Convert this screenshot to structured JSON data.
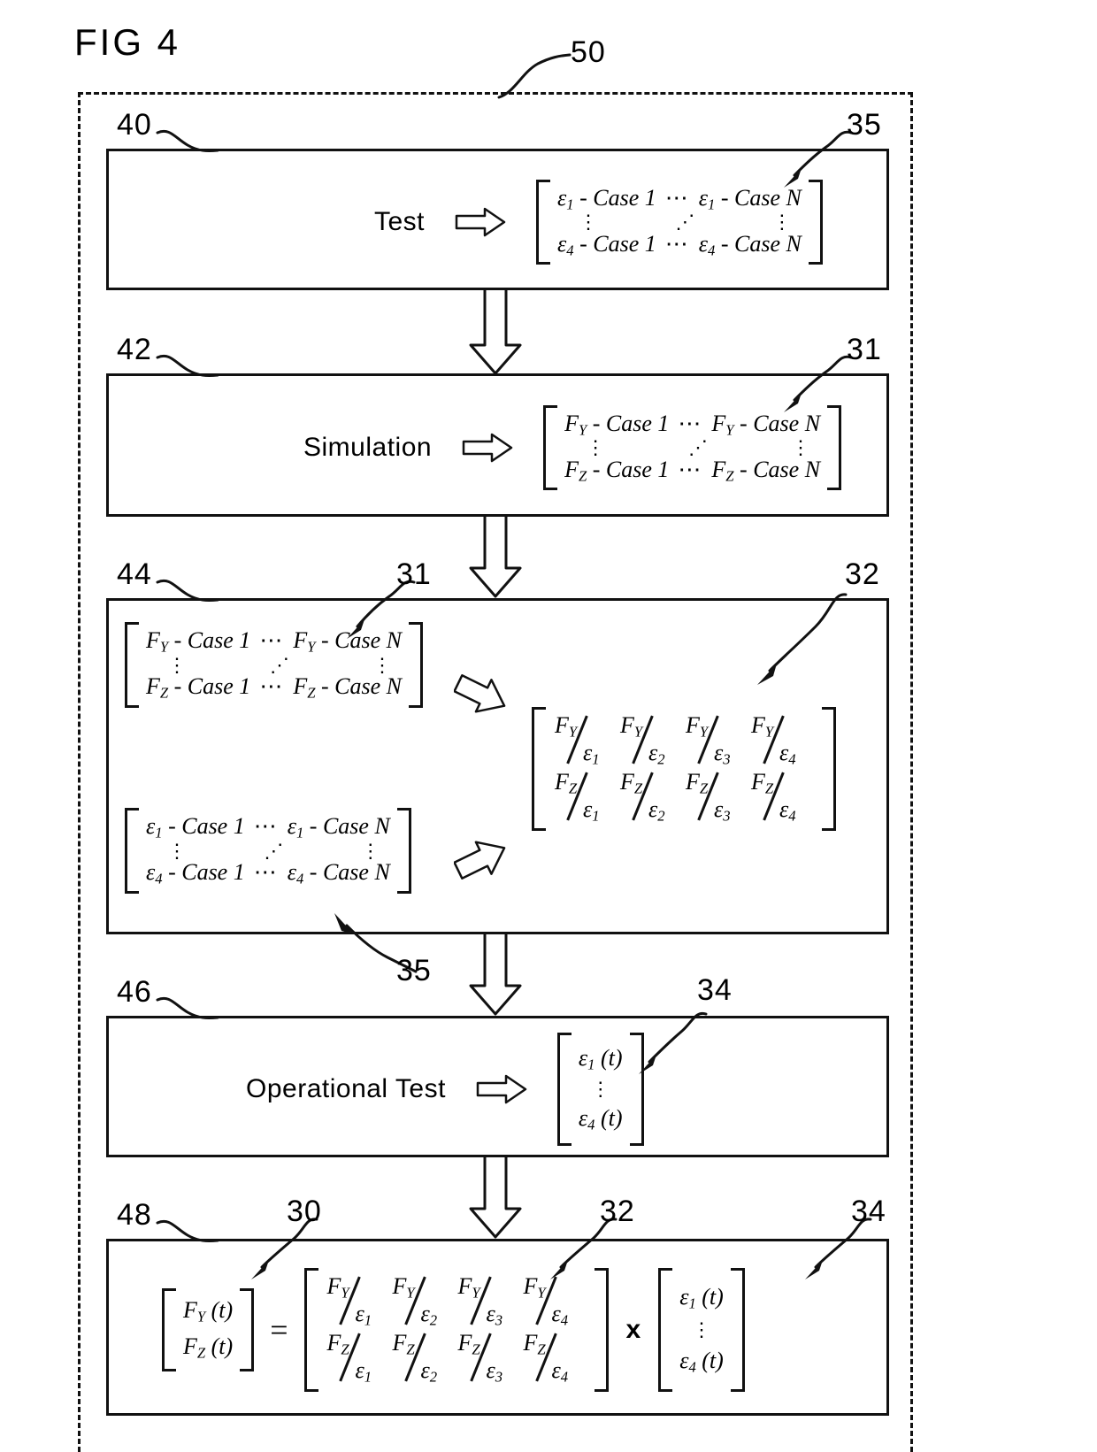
{
  "figure": {
    "title": "FIG 4",
    "outer_ref": "50"
  },
  "refs": {
    "box40": "40",
    "box42": "42",
    "box44": "44",
    "box46": "46",
    "box48": "48",
    "strain_matrix": "35",
    "force_matrix": "31",
    "force_matrix_in_44": "31",
    "sensitivity_matrix": "32",
    "sensitivity_matrix_in_48": "32",
    "strain_matrix_in_44": "35",
    "operational_strain": "34",
    "operational_strain_in_48": "34",
    "force_vector": "30"
  },
  "stages": {
    "test": "Test",
    "simulation": "Simulation",
    "operational_test": "Operational Test"
  },
  "matrices": {
    "strain_cases": {
      "row1": {
        "left": "ε1 - Case 1",
        "right": "ε1 - Case N"
      },
      "row2": {
        "left": "ε4 - Case 1",
        "right": "ε4 - Case N"
      },
      "hdots": "⋯",
      "vdots": "⋮",
      "ddots": "⋰"
    },
    "force_cases": {
      "row1": {
        "left": "FY - Case 1",
        "right": "FY - Case N"
      },
      "row2": {
        "left": "FZ - Case 1",
        "right": "FZ - Case N"
      },
      "hdots": "⋯",
      "vdots": "⋮",
      "ddots": "⋰"
    },
    "sensitivity": {
      "row1": [
        "FY/ε1",
        "FY/ε2",
        "FY/ε3",
        "FY/ε4"
      ],
      "row2": [
        "FZ/ε1",
        "FZ/ε2",
        "FZ/ε3",
        "FZ/ε4"
      ],
      "numerators_row1": [
        "F",
        "F",
        "F",
        "F"
      ],
      "numerator_subs_row1": [
        "Y",
        "Y",
        "Y",
        "Y"
      ],
      "numerators_row2": [
        "F",
        "F",
        "F",
        "F"
      ],
      "numerator_subs_row2": [
        "Z",
        "Z",
        "Z",
        "Z"
      ],
      "denominators": [
        "ε",
        "ε",
        "ε",
        "ε"
      ],
      "denominator_subs": [
        "1",
        "2",
        "3",
        "4"
      ]
    },
    "operational_strain_vector": {
      "first": "ε1 (t)",
      "vdots": "⋮",
      "last": "ε4 (t)"
    },
    "force_vector": {
      "row1": "FY (t)",
      "row2": "FZ (t)"
    }
  },
  "symbols": {
    "equals": "=",
    "times": "x",
    "flow_arrow": "arrow-right-hollow",
    "connector_arrow": "arrow-down-hollow"
  },
  "greek": {
    "epsilon": "ε",
    "subs": [
      "1",
      "2",
      "3",
      "4",
      "Y",
      "Z",
      "N",
      "t"
    ]
  }
}
